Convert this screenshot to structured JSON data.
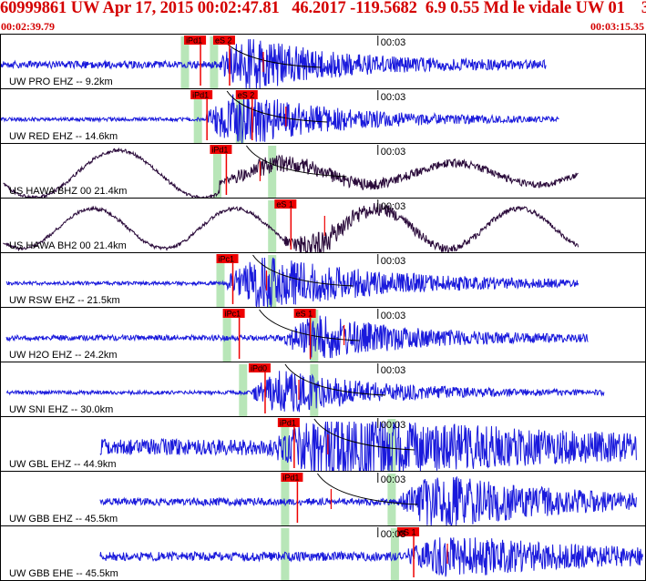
{
  "header": {
    "title": "60999861 UW Apr 17, 2015 00:02:47.81   46.2017 -119.5682  6.9 0.55 Md le vidale UW 01    3",
    "start_time": "00:02:39.79",
    "end_time": "00:03:15.35",
    "title_color": "#d40000"
  },
  "colors": {
    "trace_blue": "#1a1adc",
    "trace_dark": "#2a0a3a",
    "pick_red": "#ee0000",
    "window_green": "#b8e6b8",
    "divider": "#000000"
  },
  "time_marker": "00:03",
  "traces": [
    {
      "label": "UW PRO EHZ -- 9.2km",
      "color": "blue",
      "start": 0.0,
      "end": 0.845,
      "amp": 4,
      "burst_amp": 26,
      "burst_start": 0.34,
      "burst_dur": 0.18,
      "picks": [
        {
          "label": "iPd1",
          "pos": 0.285
        },
        {
          "label": "eS 2",
          "pos": 0.33
        }
      ],
      "windows": [
        0.28,
        0.325
      ],
      "curve": true,
      "marker_pos": 0.585
    },
    {
      "label": "UW RED EHZ -- 14.6km",
      "color": "blue",
      "start": 0.0,
      "end": 0.865,
      "amp": 2,
      "burst_amp": 28,
      "burst_start": 0.32,
      "burst_dur": 0.2,
      "picks": [
        {
          "label": "iPd1",
          "pos": 0.295
        },
        {
          "label": "eS 2",
          "pos": 0.365
        }
      ],
      "windows": [
        0.3,
        0.365
      ],
      "curve": true,
      "marker_pos": 0.585
    },
    {
      "label": "US HAWA BHZ 00 21.4km",
      "color": "dark",
      "start": 0.005,
      "end": 0.895,
      "amp": 2,
      "burst_amp": 8,
      "burst_start": 0.34,
      "burst_dur": 0.3,
      "wave_amp": 26,
      "wave_period": 0.26,
      "wave_phase": 0.3,
      "wave_damp_after": 0.34,
      "picks": [
        {
          "label": "iPd1",
          "pos": 0.325
        }
      ],
      "windows": [
        0.33,
        0.415
      ],
      "curve": true,
      "marker_pos": 0.585
    },
    {
      "label": "US HAWA BH2 00 21.4km",
      "color": "dark",
      "start": 0.005,
      "end": 0.895,
      "amp": 2,
      "burst_amp": 14,
      "burst_start": 0.44,
      "burst_dur": 0.15,
      "wave_amp": 22,
      "wave_period": 0.22,
      "wave_phase": 0.6,
      "wave_damp_after": 0.99,
      "picks": [
        {
          "label": "eS 1",
          "pos": 0.425
        }
      ],
      "windows": [
        0.415
      ],
      "curve": false,
      "marker_pos": 0.585
    },
    {
      "label": "UW RSW EHZ -- 21.5km",
      "color": "blue",
      "start": 0.01,
      "end": 0.895,
      "amp": 2,
      "burst_amp": 27,
      "burst_start": 0.35,
      "burst_dur": 0.25,
      "picks": [
        {
          "label": "iPc1",
          "pos": 0.335
        }
      ],
      "windows": [
        0.335,
        0.415
      ],
      "curve": true,
      "marker_pos": 0.585
    },
    {
      "label": "UW H2O EHZ -- 24.2km",
      "color": "blue",
      "start": 0.01,
      "end": 0.91,
      "amp": 3,
      "burst_amp": 22,
      "burst_start": 0.44,
      "burst_dur": 0.2,
      "picks": [
        {
          "label": "iPc1",
          "pos": 0.345
        },
        {
          "label": "eS 1",
          "pos": 0.455
        }
      ],
      "windows": [
        0.345,
        0.48
      ],
      "curve": true,
      "marker_pos": 0.585
    },
    {
      "label": "UW SNI EHZ -- 30.0km",
      "color": "blue",
      "start": 0.01,
      "end": 0.935,
      "amp": 2,
      "burst_amp": 22,
      "burst_start": 0.39,
      "burst_dur": 0.2,
      "picks": [
        {
          "label": "iPd0",
          "pos": 0.385
        }
      ],
      "windows": [
        0.37,
        0.48
      ],
      "curve": true,
      "marker_pos": 0.585
    },
    {
      "label": "UW GBL EHZ -- 44.9km",
      "color": "blue",
      "start": 0.155,
      "end": 0.985,
      "amp": 9,
      "burst_amp": 28,
      "burst_start": 0.43,
      "burst_dur": 0.4,
      "picks": [
        {
          "label": "iPd1",
          "pos": 0.43
        }
      ],
      "windows": [
        0.435,
        0.6
      ],
      "curve": true,
      "marker_pos": 0.585
    },
    {
      "label": "UW GBB EHZ -- 45.5km",
      "color": "blue",
      "start": 0.155,
      "end": 0.985,
      "amp": 4,
      "burst_amp": 26,
      "burst_start": 0.62,
      "burst_dur": 0.25,
      "picks": [
        {
          "label": "iPd1",
          "pos": 0.435
        }
      ],
      "windows": [
        0.435,
        0.6
      ],
      "curve": true,
      "marker_pos": 0.585
    },
    {
      "label": "UW GBB EHE -- 45.5km",
      "color": "blue",
      "start": 0.155,
      "end": 0.995,
      "amp": 5,
      "burst_amp": 18,
      "burst_start": 0.63,
      "burst_dur": 0.3,
      "picks": [
        {
          "label": "eS 1",
          "pos": 0.615
        }
      ],
      "windows": [
        0.435,
        0.605
      ],
      "curve": false,
      "marker_pos": 0.585
    }
  ]
}
